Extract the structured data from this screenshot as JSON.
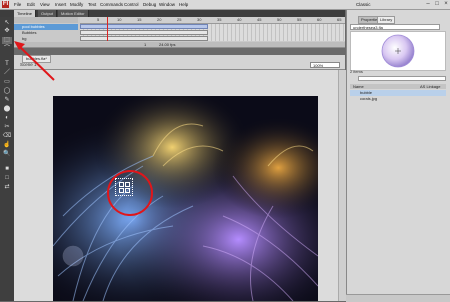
{
  "app": {
    "logo_letter": "Fl",
    "workspace": "Classic"
  },
  "menu": [
    "File",
    "Edit",
    "View",
    "Insert",
    "Modify",
    "Text",
    "Commands",
    "Control",
    "Debug",
    "Window",
    "Help"
  ],
  "window_controls": [
    "–",
    "□",
    "×"
  ],
  "panel_tabs": [
    "Timeline",
    "Output",
    "Motion Editor"
  ],
  "timeline": {
    "layers": [
      {
        "name": "pool bubbles",
        "selected": true
      },
      {
        "name": "Bubbles",
        "selected": false
      },
      {
        "name": "bg",
        "selected": false
      }
    ],
    "ruler_numbers": [
      "5",
      "10",
      "15",
      "20",
      "25",
      "30",
      "35",
      "40",
      "45",
      "50",
      "55",
      "60",
      "65"
    ],
    "current_frame": "1",
    "fps": "24.00 fps"
  },
  "tools": [
    "↖",
    "✥",
    "⬚",
    "⌒",
    "T",
    "／",
    "▭",
    "◯",
    "✎",
    "⬤",
    "◐",
    "✂",
    "⌫",
    "☝",
    "🔍",
    "■",
    "□",
    "⇄"
  ],
  "document": {
    "tab": "bubbles.fla*",
    "scene": "Scene 1",
    "zoom": "100%"
  },
  "right_panel": {
    "tabs": [
      "Properties",
      "Library"
    ],
    "library_select": "underthesea3.fla",
    "item_count": "2 items",
    "columns": {
      "name": "Name",
      "linkage": "AS Linkage"
    },
    "items": [
      {
        "name": "bubble",
        "selected": true
      },
      {
        "name": "corals.jpg",
        "selected": false
      }
    ]
  },
  "colors": {
    "accent": "#5c9ad6",
    "annotation": "#e0161a"
  }
}
